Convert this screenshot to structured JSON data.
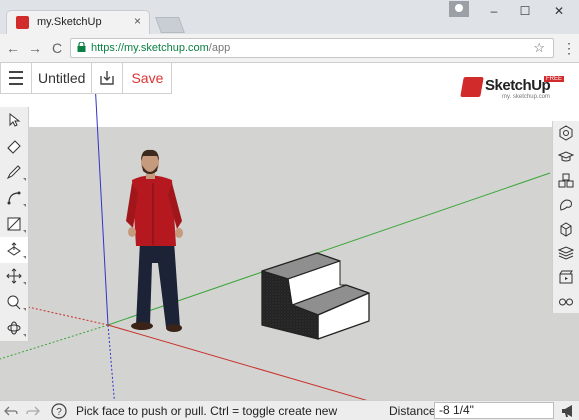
{
  "browser": {
    "tab_title": "my.SketchUp",
    "tab_close": "×",
    "url_host": "https://my.sketchup.com",
    "url_path": "/app",
    "window_minimize": "–",
    "window_maximize": "☐",
    "window_close": "✕",
    "back": "←",
    "forward": "→",
    "reload": "C",
    "bookmark_star": "☆",
    "menu_dots": "⋮"
  },
  "app": {
    "doc_title": "Untitled",
    "save_label": "Save",
    "logo_text": "SketchUp",
    "logo_badge": "FREE",
    "logo_sub": "my. sketchup.com",
    "left_tools": [
      "select-icon",
      "eraser-icon",
      "pencil-icon",
      "arc-icon",
      "rectangle-icon",
      "paint-bucket-icon",
      "move-icon",
      "tape-measure-icon",
      "orbit-icon"
    ],
    "active_tool": "paint-bucket-icon",
    "right_tools": [
      "entity-info-icon",
      "instructor-icon",
      "components-icon",
      "materials-icon",
      "styles-icon",
      "layers-icon",
      "scenes-icon",
      "display-icon"
    ]
  },
  "status": {
    "hint": "Pick face to push or pull. Ctrl = toggle create new",
    "distance_label": "Distance",
    "distance_value": "-8 1/4\""
  },
  "colors": {
    "ground": "#d3d3d1",
    "accent": "#d12b2b",
    "axis_red": "#c8302a",
    "axis_green": "#3aa638",
    "axis_blue": "#3235c8"
  }
}
